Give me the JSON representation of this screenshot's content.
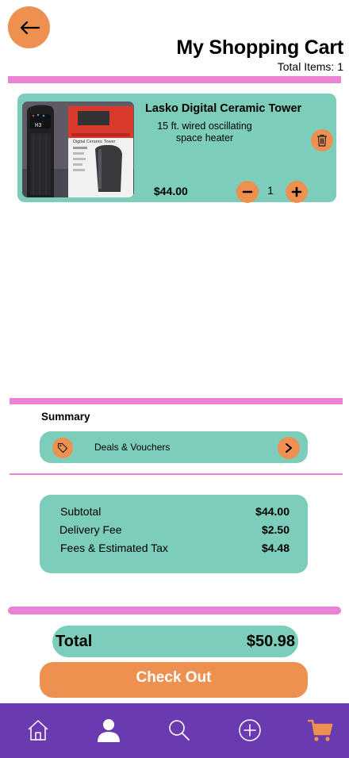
{
  "header": {
    "title": "My Shopping Cart",
    "total_items": "Total Items: 1"
  },
  "cart": {
    "items": [
      {
        "name": "Lasko Digital Ceramic Tower",
        "description": "15 ft. wired oscillating space heater",
        "price": "$44.00",
        "quantity": "1",
        "image_box_text": "Digital Ceramic Tower",
        "image_display_text": "H3"
      }
    ]
  },
  "summary": {
    "label": "Summary",
    "deals_label": "Deals & Vouchers"
  },
  "fees": {
    "subtotal_label": "Subtotal",
    "subtotal_value": "$44.00",
    "delivery_label": "Delivery Fee",
    "delivery_value": "$2.50",
    "tax_label": "Fees & Estimated Tax",
    "tax_value": "$4.48"
  },
  "total": {
    "label": "Total",
    "value": "$50.98"
  },
  "checkout_label": "Check Out",
  "bottom_nav": {
    "items": [
      "home-icon",
      "profile-icon",
      "search-icon",
      "add-icon",
      "cart-icon"
    ],
    "active": "cart-icon"
  },
  "colors": {
    "accent_orange": "#ee9150",
    "teal": "#7dcdbb",
    "pink_divider": "#ea83d3",
    "nav_purple": "#6a3bb0"
  }
}
